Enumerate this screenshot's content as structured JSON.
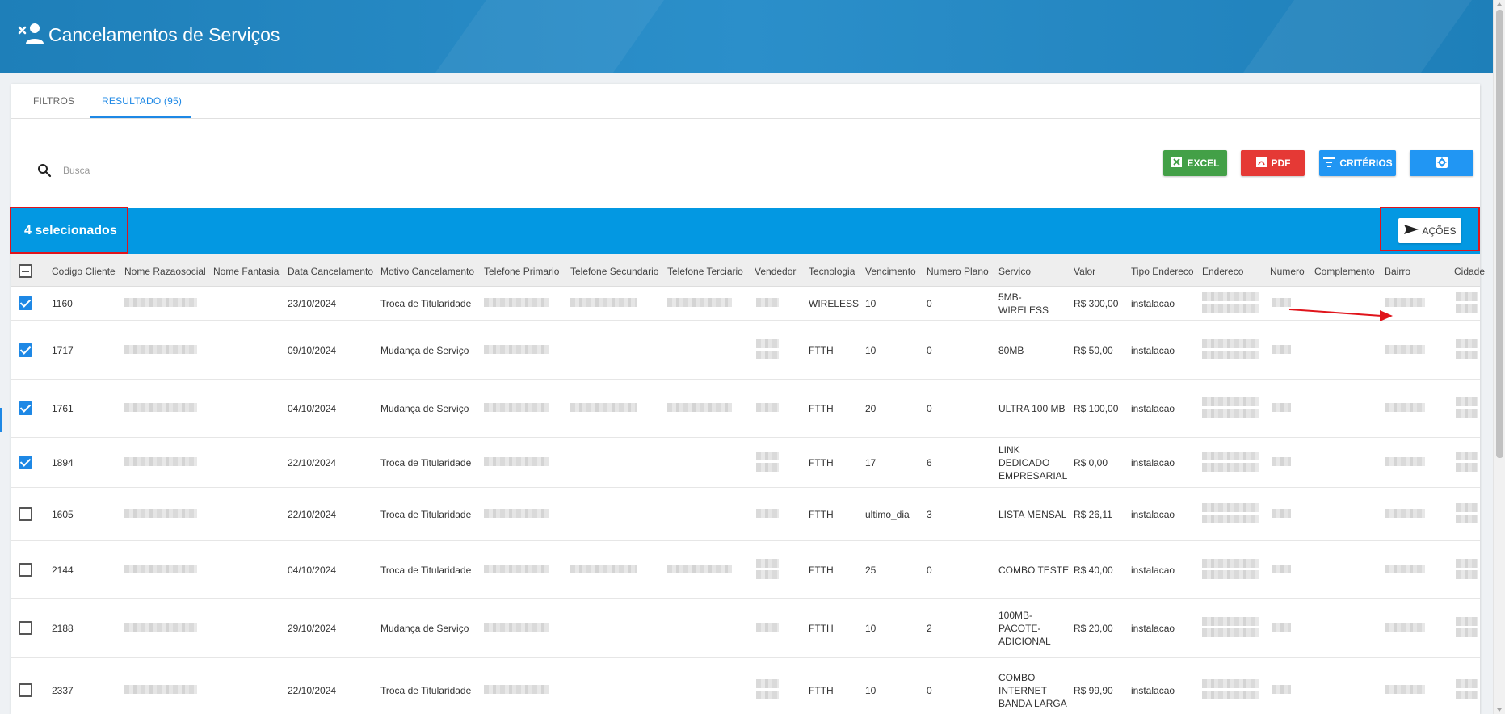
{
  "header": {
    "title": "Cancelamentos de Serviços"
  },
  "tabs": [
    {
      "label": "FILTROS"
    },
    {
      "label": "RESULTADO (95)"
    }
  ],
  "search": {
    "placeholder": "Busca"
  },
  "buttons": {
    "excel": "EXCEL",
    "pdf": "PDF",
    "criterios": "CRITÉRIOS"
  },
  "selection": {
    "text": "4 selecionados",
    "actions_label": "AÇÕES"
  },
  "colors": {
    "header": "#1e7fb9",
    "selection_bar": "#0398e2",
    "excel": "#43a047",
    "pdf": "#e53935",
    "blue_btn": "#2196f3",
    "highlight": "#e0141b"
  },
  "columns": [
    "Codigo Cliente",
    "Nome Razaosocial",
    "Nome Fantasia",
    "Data Cancelamento",
    "Motivo Cancelamento",
    "Telefone Primario",
    "Telefone Secundario",
    "Telefone Terciario",
    "Vendedor",
    "Tecnologia",
    "Vencimento",
    "Numero Plano",
    "Servico",
    "Valor",
    "Tipo Endereco",
    "Endereco",
    "Numero",
    "Complemento",
    "Bairro",
    "Cidade"
  ],
  "rows": [
    {
      "codigo": "1160",
      "data": "23/10/2024",
      "motivo": "Troca de Titularidade",
      "tecnologia": "WIRELESS",
      "vencimento": "10",
      "plano": "0",
      "servico": [
        "5MB-",
        "WIRELESS"
      ],
      "valor": "R$ 300,00",
      "tipo": "instalacao",
      "checked": true
    },
    {
      "codigo": "1717",
      "data": "09/10/2024",
      "motivo": "Mudança de Serviço",
      "tecnologia": "FTTH",
      "vencimento": "10",
      "plano": "0",
      "servico": [
        "80MB"
      ],
      "valor": "R$ 50,00",
      "tipo": "instalacao",
      "checked": true
    },
    {
      "codigo": "1761",
      "data": "04/10/2024",
      "motivo": "Mudança de Serviço",
      "tecnologia": "FTTH",
      "vencimento": "20",
      "plano": "0",
      "servico": [
        "ULTRA 100 MB"
      ],
      "valor": "R$ 100,00",
      "tipo": "instalacao",
      "checked": true
    },
    {
      "codigo": "1894",
      "data": "22/10/2024",
      "motivo": "Troca de Titularidade",
      "tecnologia": "FTTH",
      "vencimento": "17",
      "plano": "6",
      "servico": [
        "LINK",
        "DEDICADO",
        "EMPRESARIAL"
      ],
      "valor": "R$ 0,00",
      "tipo": "instalacao",
      "checked": true
    },
    {
      "codigo": "1605",
      "data": "22/10/2024",
      "motivo": "Troca de Titularidade",
      "tecnologia": "FTTH",
      "vencimento": "ultimo_dia",
      "plano": "3",
      "servico": [
        "LISTA MENSAL"
      ],
      "valor": "R$ 26,11",
      "tipo": "instalacao",
      "checked": false
    },
    {
      "codigo": "2144",
      "data": "04/10/2024",
      "motivo": "Troca de Titularidade",
      "tecnologia": "FTTH",
      "vencimento": "25",
      "plano": "0",
      "servico": [
        "COMBO TESTE"
      ],
      "valor": "R$ 40,00",
      "tipo": "instalacao",
      "checked": false
    },
    {
      "codigo": "2188",
      "data": "29/10/2024",
      "motivo": "Mudança de Serviço",
      "tecnologia": "FTTH",
      "vencimento": "10",
      "plano": "2",
      "servico": [
        "100MB-",
        "PACOTE-",
        "ADICIONAL"
      ],
      "valor": "R$ 20,00",
      "tipo": "instalacao",
      "checked": false
    },
    {
      "codigo": "2337",
      "data": "22/10/2024",
      "motivo": "Troca de Titularidade",
      "tecnologia": "FTTH",
      "vencimento": "10",
      "plano": "0",
      "servico": [
        "COMBO",
        "INTERNET",
        "BANDA LARGA"
      ],
      "valor": "R$ 99,90",
      "tipo": "instalacao",
      "checked": false
    }
  ]
}
